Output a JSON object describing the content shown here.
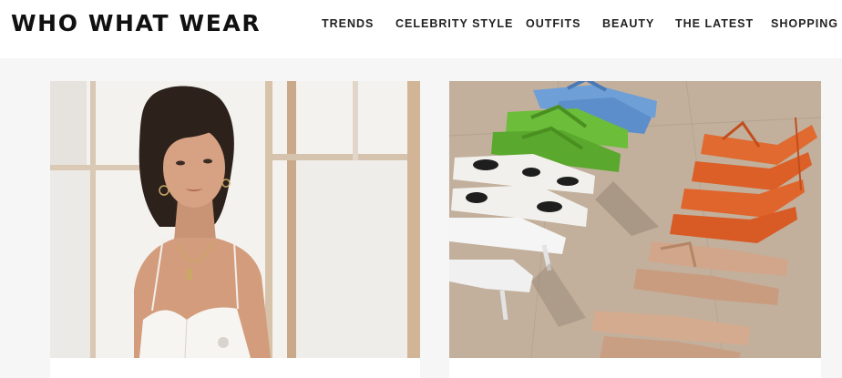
{
  "header": {
    "logo": "WHO WHAT WEAR",
    "nav": [
      {
        "label": "TRENDS"
      },
      {
        "label": "CELEBRITY STYLE"
      },
      {
        "label": "OUTFITS"
      },
      {
        "label": "BEAUTY"
      },
      {
        "label": "THE LATEST"
      },
      {
        "label": "SHOPPING"
      }
    ]
  },
  "articles": [
    {
      "image": "woman-in-white-top-by-window"
    },
    {
      "image": "rows-of-strappy-sandals-on-stone-floor"
    }
  ],
  "colors": {
    "header_bg": "#ffffff",
    "page_bg": "#f6f6f6",
    "text": "#111111"
  }
}
